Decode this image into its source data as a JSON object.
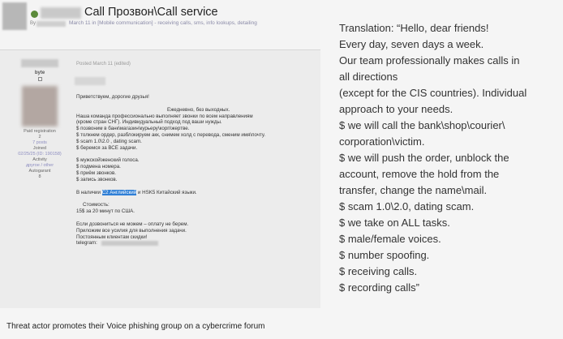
{
  "forum": {
    "thread_title": "Call Прозвон\\Call service",
    "thread_by": "By",
    "thread_meta": "March 11 in [Mobile communication] - receiving calls, sms, info lookups, detailing",
    "user": {
      "title": "byte",
      "stats": [
        "Paid registration",
        "2",
        "7 posts",
        "Joined",
        "02/25/25 (ID: 190158)",
        "Activity",
        "другое / other",
        "Autogarant",
        "8"
      ]
    },
    "post_header": "Posted March 11 (edited)",
    "post_lines": [
      {
        "text": "Приветствуем, дорогие друзья!",
        "style": ""
      },
      {
        "text": "",
        "style": "gap"
      },
      {
        "text": "Ежедневно, без выходных.",
        "style": "center"
      },
      {
        "text": "Наша команда профессионально выполняет звонки по всем направлениям",
        "style": ""
      },
      {
        "text": "(кроме стран СНГ). Индивидуальный подход под ваши нужды.",
        "style": ""
      },
      {
        "text": "$ позвоним в банк\\магазин\\курьеру\\корп\\жертве.",
        "style": ""
      },
      {
        "text": "$ толкнем ордер, разблокируем акк, снимем холд с перевода, сменим имя\\почту.",
        "style": ""
      },
      {
        "text": "$ scam 1.0\\2.0 , dating scam.",
        "style": ""
      },
      {
        "text": "$ беремся за ВСЕ задачи.",
        "style": ""
      },
      {
        "text": "",
        "style": "gap"
      },
      {
        "text": "$ мужской\\женский голоса.",
        "style": ""
      },
      {
        "text": "$ подмена номера.",
        "style": ""
      },
      {
        "text": "$ приём звонков.",
        "style": ""
      },
      {
        "text": "$ запись звонков.",
        "style": ""
      },
      {
        "text": "",
        "style": "gap"
      }
    ],
    "langs": {
      "prefix": "В наличии",
      "highlight": "C2 Английский",
      "suffix": "и HSK5 Китайский языки."
    },
    "price_lines": [
      {
        "text": "Стоимость:",
        "style": "indent"
      },
      {
        "text": "15$ за 20 минут по США.",
        "style": ""
      },
      {
        "text": "",
        "style": "gap"
      },
      {
        "text": "Если дозвониться не можем – оплату не берем.",
        "style": ""
      },
      {
        "text": "Приложим все усилия для выполнения задачи.",
        "style": ""
      },
      {
        "text": "Постоянным клиентам скидки!",
        "style": ""
      }
    ],
    "telegram_label": "telegram:"
  },
  "caption": "Threat actor promotes their Voice phishing group on a cybercrime forum",
  "translation": [
    "Translation: “Hello, dear friends!",
    "Every day, seven days a week.",
    "Our team professionally makes calls in",
    "all directions",
    "(except for the CIS countries). Individual",
    "approach to your needs.",
    "$ we will call the bank\\shop\\courier\\",
    "corporation\\victim.",
    "$ we will push the order, unblock the",
    "account, remove the hold from the",
    "transfer, change the name\\mail.",
    "$ scam 1.0\\2.0, dating scam.",
    "$ we take on ALL tasks.",
    "$ male/female voices.",
    "$ number spoofing.",
    "$ receiving calls.",
    "$ recording calls”"
  ]
}
